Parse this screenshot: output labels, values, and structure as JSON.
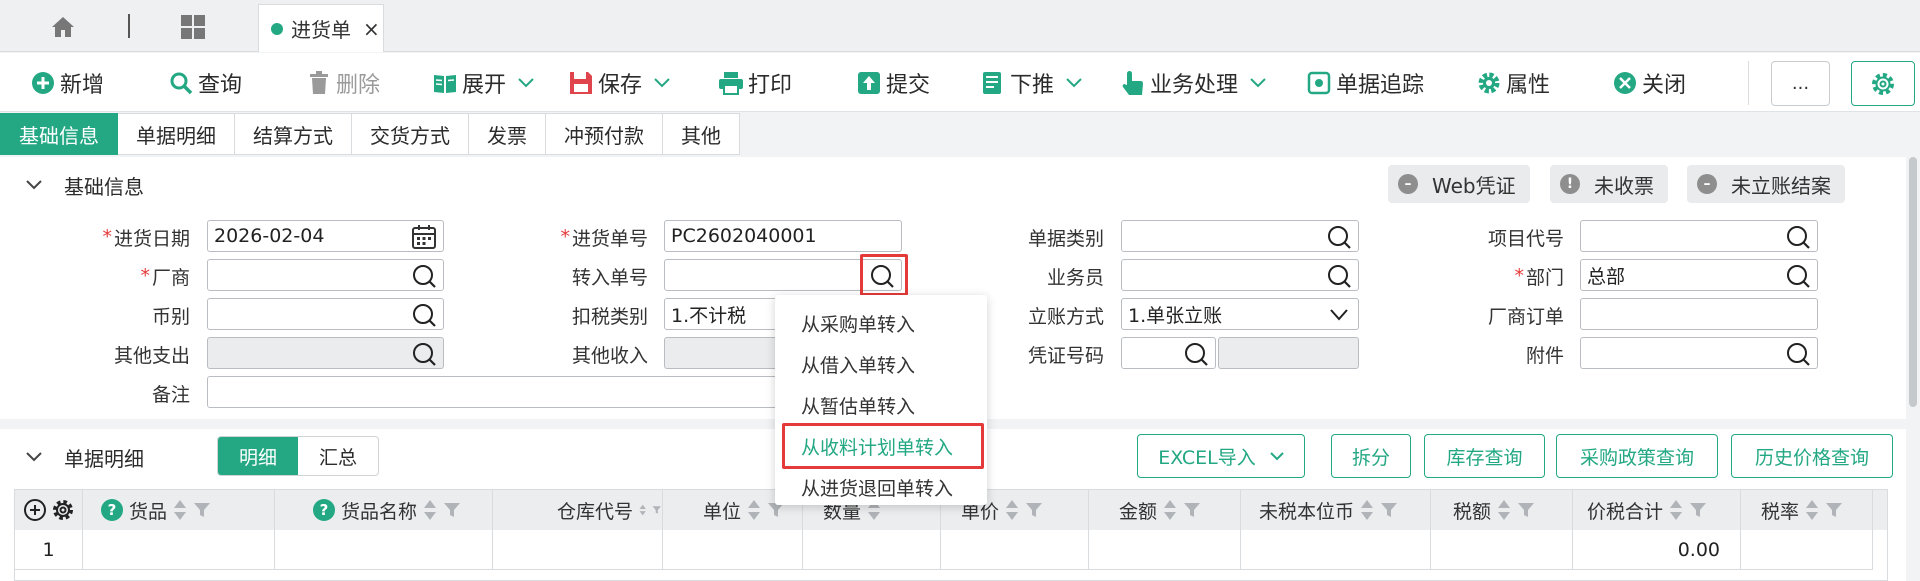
{
  "tab_strip": {
    "doc_tab": "进货单",
    "close_glyph": "×"
  },
  "toolbar": {
    "add": "新增",
    "query": "查询",
    "delete": "删除",
    "expand": "展开",
    "save": "保存",
    "print": "打印",
    "submit": "提交",
    "push_down": "下推",
    "business": "业务处理",
    "trace": "单据追踪",
    "properties": "属性",
    "close": "关闭",
    "more": "..."
  },
  "section_tabs": [
    "基础信息",
    "单据明细",
    "结算方式",
    "交货方式",
    "发票",
    "冲预付款",
    "其他"
  ],
  "basic_section": {
    "title": "基础信息",
    "pills": [
      "Web凭证",
      "未收票",
      "未立账结案"
    ]
  },
  "form": {
    "purchase_date": {
      "label": "进货日期",
      "value": "2026-02-04"
    },
    "vendor": {
      "label": "厂商",
      "value": ""
    },
    "currency": {
      "label": "币别",
      "value": ""
    },
    "other_expense": {
      "label": "其他支出",
      "value": ""
    },
    "remark": {
      "label": "备注",
      "value": ""
    },
    "purchase_no": {
      "label": "进货单号",
      "value": "PC2602040001"
    },
    "transfer_no": {
      "label": "转入单号",
      "value": ""
    },
    "tax_type": {
      "label": "扣税类别",
      "value": "1.不计税"
    },
    "other_income": {
      "label": "其他收入",
      "value": ""
    },
    "doc_type": {
      "label": "单据类别",
      "value": ""
    },
    "salesperson": {
      "label": "业务员",
      "value": ""
    },
    "account_mode": {
      "label": "立账方式",
      "value": "1.单张立账"
    },
    "voucher_no": {
      "label": "凭证号码",
      "value": ""
    },
    "project_code": {
      "label": "项目代号",
      "value": ""
    },
    "department": {
      "label": "部门",
      "value": "总部"
    },
    "vendor_order": {
      "label": "厂商订单",
      "value": ""
    },
    "attachment": {
      "label": "附件",
      "value": ""
    }
  },
  "transfer_menu": [
    "从采购单转入",
    "从借入单转入",
    "从暂估单转入",
    "从收料计划单转入",
    "从进货退回单转入"
  ],
  "detail_section": {
    "title": "单据明细",
    "seg_detail": "明细",
    "seg_summary": "汇总",
    "buttons": {
      "excel": "EXCEL导入",
      "split": "拆分",
      "stock": "库存查询",
      "policy": "采购政策查询",
      "history": "历史价格查询"
    }
  },
  "grid": {
    "columns": [
      "货品",
      "货品名称",
      "仓库代号",
      "单位",
      "数量",
      "单价",
      "金额",
      "未税本位币",
      "税额",
      "价税合计",
      "税率"
    ],
    "rows": [
      {
        "index": "1",
        "total": "0.00"
      }
    ]
  },
  "colors": {
    "accent": "#23a883",
    "alert": "#e43a3a"
  }
}
